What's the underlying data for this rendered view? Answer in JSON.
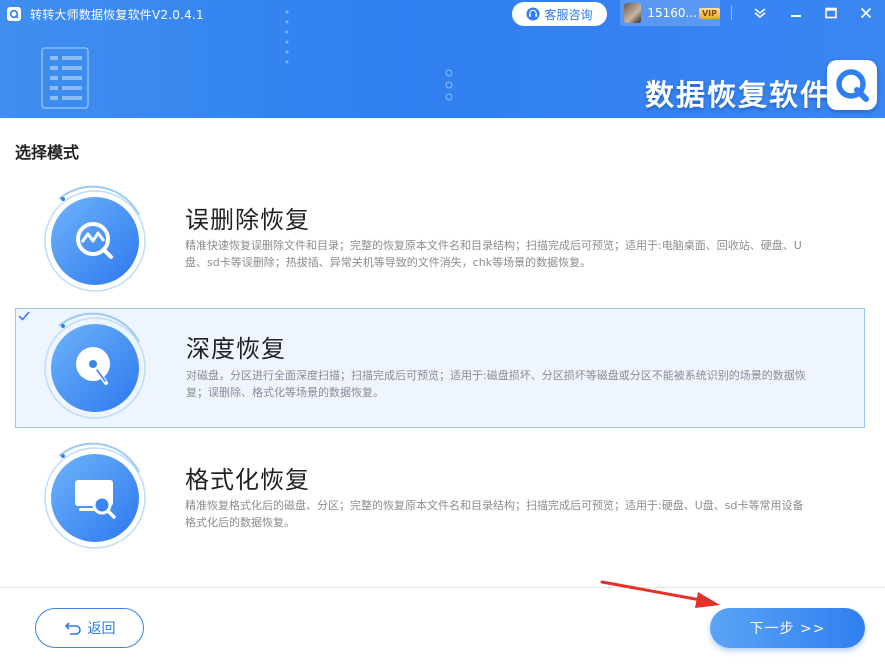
{
  "window": {
    "title": "转转大师数据恢复软件V2.0.4.1",
    "service_label": "客服咨询",
    "user_name": "15160...",
    "vip_badge": "VIP"
  },
  "banner": {
    "text": "数据恢复软件"
  },
  "section_title": "选择模式",
  "modes": [
    {
      "title": "误删除恢复",
      "desc": "精准快速恢复误删除文件和目录；完整的恢复原本文件名和目录结构；扫描完成后可预览；适用于:电脑桌面、回收站、硬盘、U盘、sd卡等误删除；热拔插、异常关机等导致的文件消失，chk等场景的数据恢复。",
      "selected": false
    },
    {
      "title": "深度恢复",
      "desc": "对磁盘，分区进行全面深度扫描；扫描完成后可预览；适用于:磁盘损坏、分区损坏等磁盘或分区不能被系统识别的场景的数据恢复；误删除、格式化等场景的数据恢复。",
      "selected": true
    },
    {
      "title": "格式化恢复",
      "desc": "精准恢复格式化后的磁盘、分区；完整的恢复原本文件名和目录结构；扫描完成后可预览；适用于:硬盘、U盘、sd卡等常用设备格式化后的数据恢复。",
      "selected": false
    }
  ],
  "footer": {
    "back_label": "返回",
    "next_label": "下一步 >>"
  },
  "colors": {
    "accent": "#2f7ff0",
    "selected_bg": "#eef5fe",
    "arrow": "#e8302a"
  }
}
